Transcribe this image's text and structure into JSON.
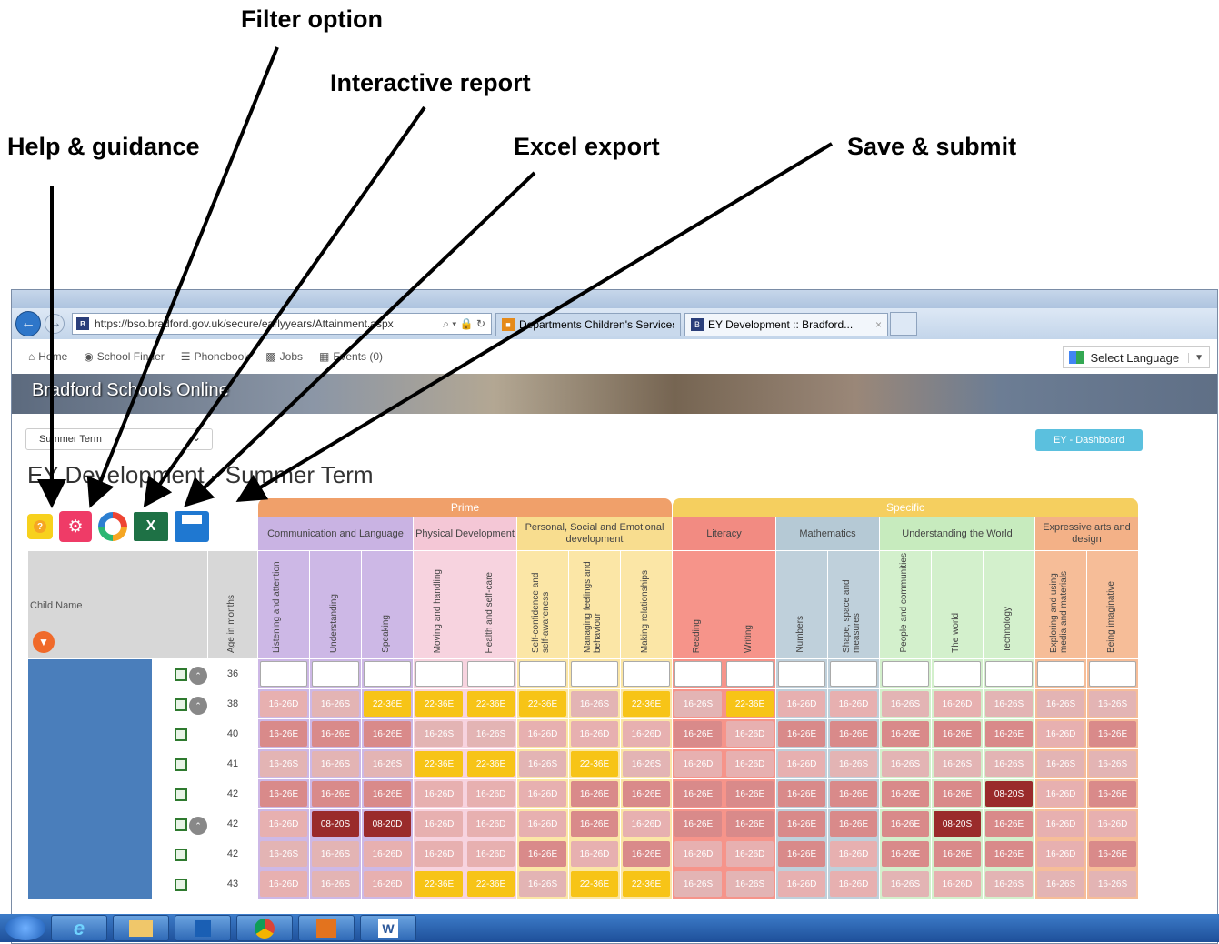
{
  "callouts": {
    "filter": "Filter option",
    "report": "Interactive report",
    "help": "Help & guidance",
    "excel": "Excel  export",
    "save": "Save & submit"
  },
  "browser": {
    "url": "https://bso.bradford.gov.uk/secure/earlyyears/Attainment.aspx",
    "search_glyphs": "⌕ ▾ 🔒 ↻",
    "tabs": [
      {
        "label": "Departments Children's Services",
        "icon": "cs"
      },
      {
        "label": "EY Development :: Bradford...",
        "icon": "bso",
        "close": "×"
      }
    ]
  },
  "menu": {
    "items": [
      {
        "name": "home",
        "label": "Home",
        "icon": "home-icon"
      },
      {
        "name": "school-finder",
        "label": "School Finder",
        "icon": "eye-icon"
      },
      {
        "name": "phonebook",
        "label": "Phonebook",
        "icon": "list-icon"
      },
      {
        "name": "jobs",
        "label": "Jobs",
        "icon": "briefcase-icon"
      },
      {
        "name": "events",
        "label": "Events (0)",
        "icon": "calendar-icon"
      }
    ],
    "language": "Select Language"
  },
  "banner": {
    "title": "Bradford Schools Online"
  },
  "page": {
    "term_select": "Summer Term",
    "dashboard_button": "EY - Dashboard",
    "title": "EY Development - Summer Term"
  },
  "toolbar": {
    "help": "?",
    "filter": "⚙",
    "excel": "X"
  },
  "grid": {
    "groups": [
      {
        "label": "Prime",
        "span": 8
      },
      {
        "label": "Specific",
        "span": 9
      }
    ],
    "areas": [
      {
        "label": "Communication and Language",
        "span": 3,
        "color": "#c9b3e3"
      },
      {
        "label": "Physical Development",
        "span": 2,
        "color": "#f4c7d6"
      },
      {
        "label": "Personal, Social and Emotional development",
        "span": 3,
        "color": "#f8dd8f"
      },
      {
        "label": "Literacy",
        "span": 2,
        "color": "#f28b82"
      },
      {
        "label": "Mathematics",
        "span": 2,
        "color": "#b5c9d5"
      },
      {
        "label": "Understanding the World",
        "span": 3,
        "color": "#c7ebbe"
      },
      {
        "label": "Expressive arts and design",
        "span": 2,
        "color": "#f3b187"
      }
    ],
    "child_name_header": "Child Name",
    "age_header": "Age in months",
    "columns": [
      {
        "label": "Listening and attention",
        "bg": "#cdb8e6"
      },
      {
        "label": "Understanding",
        "bg": "#cdb8e6"
      },
      {
        "label": "Speaking",
        "bg": "#cdb8e6"
      },
      {
        "label": "Moving and handling",
        "bg": "#f7d3df"
      },
      {
        "label": "Health and self-care",
        "bg": "#f7d3df"
      },
      {
        "label": "Self-confidence and self-awareness",
        "bg": "#fbe6a6"
      },
      {
        "label": "Managing feelings and behaviour",
        "bg": "#fbe6a6"
      },
      {
        "label": "Making relationships",
        "bg": "#fbe6a6"
      },
      {
        "label": "Reading",
        "bg": "#f6948a"
      },
      {
        "label": "Writing",
        "bg": "#f6948a"
      },
      {
        "label": "Numbers",
        "bg": "#bfd0db"
      },
      {
        "label": "Shape, space and measures",
        "bg": "#bfd0db"
      },
      {
        "label": "People and communities",
        "bg": "#d3f0cc"
      },
      {
        "label": "The world",
        "bg": "#d3f0cc"
      },
      {
        "label": "Technology",
        "bg": "#d3f0cc"
      },
      {
        "label": "Exploring and using media and materials",
        "bg": "#f6bd98"
      },
      {
        "label": "Being imaginative",
        "bg": "#f6bd98"
      }
    ],
    "rows": [
      {
        "age": "36",
        "toggle": true,
        "cells": [
          "",
          "",
          "",
          "",
          "",
          "",
          "",
          "",
          "",
          "",
          "",
          "",
          "",
          "",
          "",
          "",
          ""
        ]
      },
      {
        "age": "38",
        "toggle": true,
        "cells": [
          "16-26D",
          "16-26S",
          "22-36E",
          "22-36E",
          "22-36E",
          "22-36E",
          "16-26S",
          "22-36E",
          "16-26S",
          "22-36E",
          "16-26D",
          "16-26D",
          "16-26S",
          "16-26D",
          "16-26S",
          "16-26S",
          "16-26S"
        ]
      },
      {
        "age": "40",
        "toggle": false,
        "cells": [
          "16-26E",
          "16-26E",
          "16-26E",
          "16-26S",
          "16-26S",
          "16-26D",
          "16-26D",
          "16-26D",
          "16-26E",
          "16-26D",
          "16-26E",
          "16-26E",
          "16-26E",
          "16-26E",
          "16-26E",
          "16-26D",
          "16-26E"
        ]
      },
      {
        "age": "41",
        "toggle": false,
        "cells": [
          "16-26S",
          "16-26S",
          "16-26S",
          "22-36E",
          "22-36E",
          "16-26S",
          "22-36E",
          "16-26S",
          "16-26D",
          "16-26D",
          "16-26D",
          "16-26S",
          "16-26S",
          "16-26S",
          "16-26S",
          "16-26S",
          "16-26S"
        ]
      },
      {
        "age": "42",
        "toggle": false,
        "cells": [
          "16-26E",
          "16-26E",
          "16-26E",
          "16-26D",
          "16-26D",
          "16-26D",
          "16-26E",
          "16-26E",
          "16-26E",
          "16-26E",
          "16-26E",
          "16-26E",
          "16-26E",
          "16-26E",
          "08-20S",
          "16-26D",
          "16-26E"
        ]
      },
      {
        "age": "42",
        "toggle": true,
        "cells": [
          "16-26D",
          "08-20S",
          "08-20D",
          "16-26D",
          "16-26D",
          "16-26D",
          "16-26E",
          "16-26D",
          "16-26E",
          "16-26E",
          "16-26E",
          "16-26E",
          "16-26E",
          "08-20S",
          "16-26E",
          "16-26D",
          "16-26D"
        ]
      },
      {
        "age": "42",
        "toggle": false,
        "cells": [
          "16-26S",
          "16-26S",
          "16-26D",
          "16-26D",
          "16-26D",
          "16-26E",
          "16-26D",
          "16-26E",
          "16-26D",
          "16-26D",
          "16-26E",
          "16-26D",
          "16-26E",
          "16-26E",
          "16-26E",
          "16-26D",
          "16-26E"
        ]
      },
      {
        "age": "43",
        "toggle": false,
        "cells": [
          "16-26D",
          "16-26S",
          "16-26D",
          "22-36E",
          "22-36E",
          "16-26S",
          "22-36E",
          "22-36E",
          "16-26S",
          "16-26S",
          "16-26D",
          "16-26D",
          "16-26S",
          "16-26D",
          "16-26S",
          "16-26S",
          "16-26S"
        ]
      }
    ]
  },
  "taskbar": {
    "word_label": "W"
  }
}
